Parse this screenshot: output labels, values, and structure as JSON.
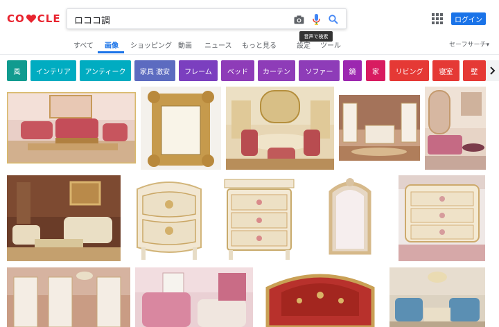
{
  "logo": {
    "letters_left": "GO",
    "letters_right": "CLE",
    "colors": {
      "G": "#e8242f",
      "O": "#e8242f",
      "heart": "#e8242f",
      "C": "#e8242f",
      "L": "#e8242f",
      "E": "#e8242f"
    }
  },
  "search": {
    "query": "ロココ調",
    "voice_tooltip": "音声で検索"
  },
  "header": {
    "login_label": "ログイン"
  },
  "tabs": [
    {
      "label": "すべて",
      "active": false
    },
    {
      "label": "画像",
      "active": true
    },
    {
      "label": "ショッピング",
      "active": false
    },
    {
      "label": "動画",
      "active": false
    },
    {
      "label": "ニュース",
      "active": false
    },
    {
      "label": "もっと見る",
      "active": false
    },
    {
      "label": "設定",
      "active": false
    },
    {
      "label": "ツール",
      "active": false
    }
  ],
  "safesearch_label": "セーフサーチ▾",
  "chips": [
    {
      "label": "風",
      "color": "#119b8f"
    },
    {
      "label": "インテリア",
      "color": "#00acc1"
    },
    {
      "label": "アンティーク",
      "color": "#00acc1"
    },
    {
      "label": "家具 激安",
      "color": "#5c6bc0"
    },
    {
      "label": "フレーム",
      "color": "#7b3fbf"
    },
    {
      "label": "ベッド",
      "color": "#8e3cb8"
    },
    {
      "label": "カーテン",
      "color": "#8e3cb8"
    },
    {
      "label": "ソファー",
      "color": "#8e3cb8"
    },
    {
      "label": "鏡",
      "color": "#9c27b0"
    },
    {
      "label": "家",
      "color": "#d81b60"
    },
    {
      "label": "リビング",
      "color": "#e53935"
    },
    {
      "label": "寝室",
      "color": "#e53935"
    },
    {
      "label": "壁",
      "color": "#e53935"
    }
  ],
  "images": [
    {
      "subject": "living-room-pink-sofas"
    },
    {
      "subject": "ornate-gold-frame"
    },
    {
      "subject": "dining-room-gold"
    },
    {
      "subject": "white-display-cabinets"
    },
    {
      "subject": "pink-bedroom"
    },
    {
      "subject": "brown-living-room"
    },
    {
      "subject": "white-gold-chest-1"
    },
    {
      "subject": "white-gold-chest-2"
    },
    {
      "subject": "ornate-mirror"
    },
    {
      "subject": "white-gold-chest-3"
    },
    {
      "subject": "cabinet-room"
    },
    {
      "subject": "pink-bedroom-2"
    },
    {
      "subject": "red-ornate-sofa"
    },
    {
      "subject": "blue-living-room"
    }
  ]
}
